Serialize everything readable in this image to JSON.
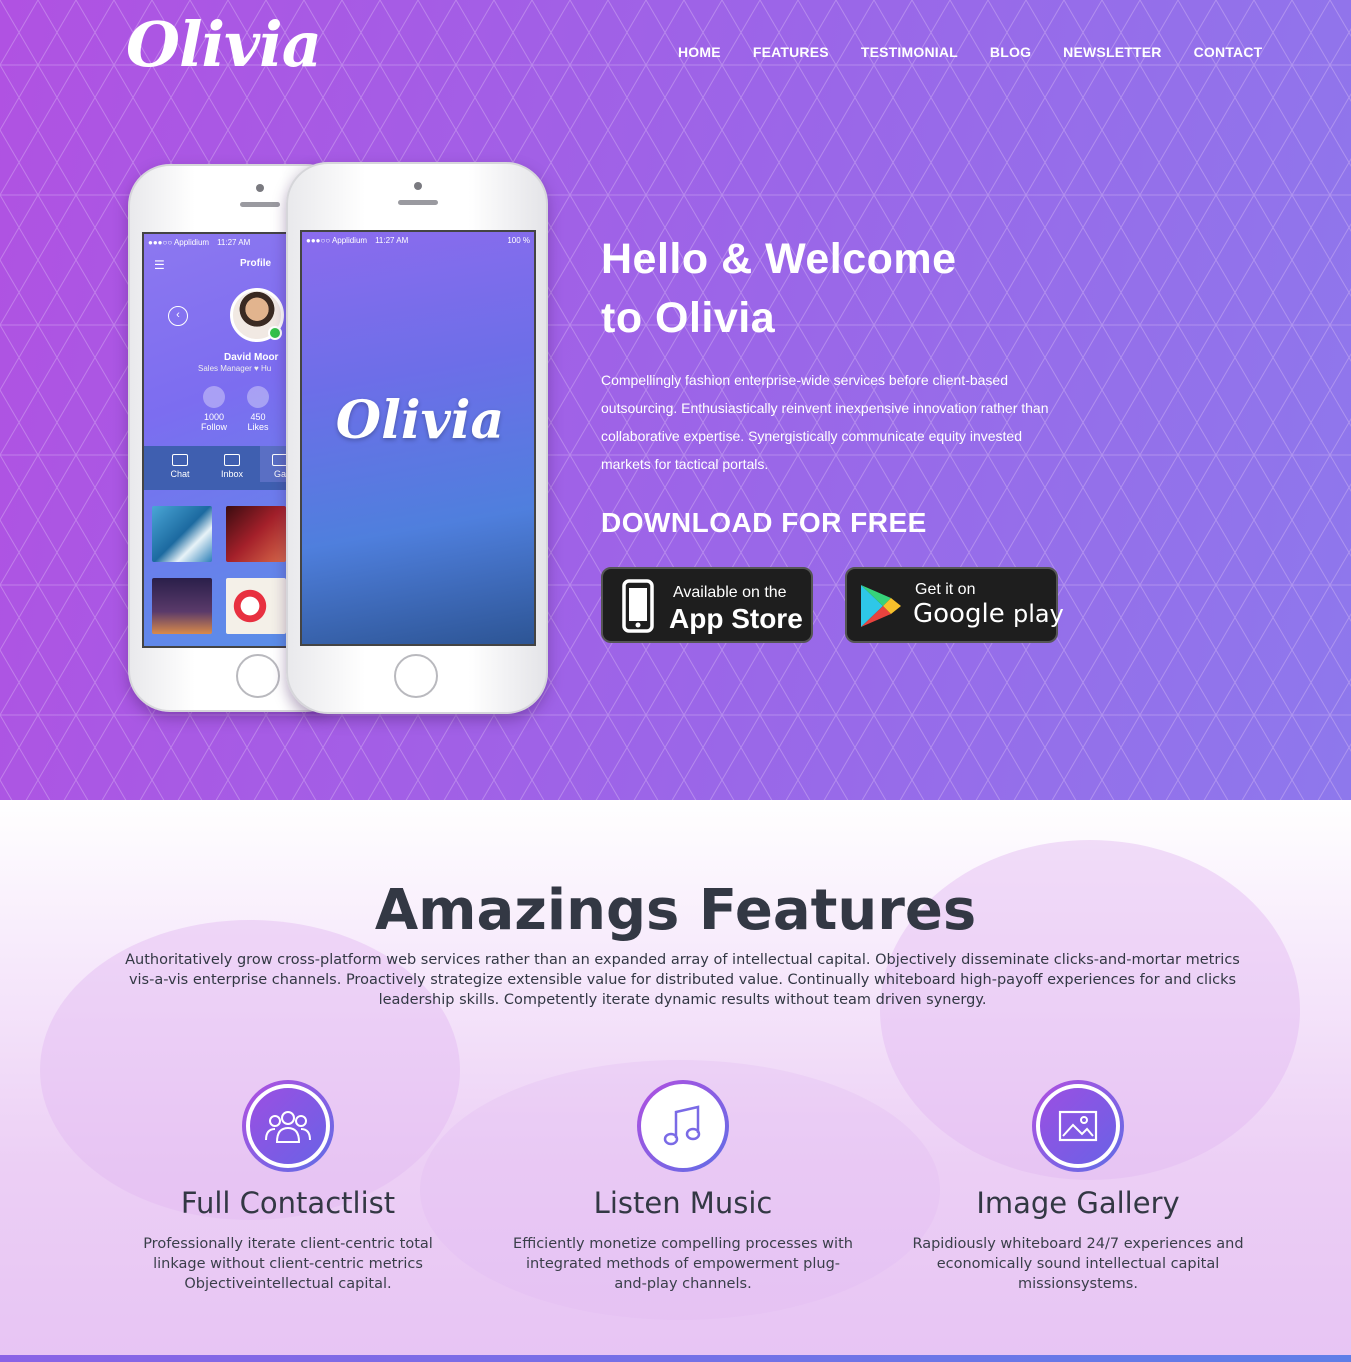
{
  "brand": {
    "logo_text": "Olivia"
  },
  "nav": {
    "items": [
      {
        "label": "HOME"
      },
      {
        "label": "FEATURES"
      },
      {
        "label": "TESTIMONIAL"
      },
      {
        "label": "BLOG"
      },
      {
        "label": "NEWSLETTER"
      },
      {
        "label": "CONTACT"
      }
    ]
  },
  "hero": {
    "title_line1": "Hello & Welcome",
    "title_line2": "to Olivia",
    "description": "Compellingly fashion enterprise-wide services before client-based outsourcing. Enthusiastically reinvent inexpensive innovation rather than collaborative expertise. Synergistically communicate equity invested markets for tactical portals.",
    "download_label": "DOWNLOAD FOR FREE",
    "app_store": {
      "small": "Available on the",
      "big": "App Store"
    },
    "google_play": {
      "small": "Get it on",
      "big_google": "Google",
      "big_play": "play"
    }
  },
  "phone_back": {
    "carrier": "●●●○○ Applidium",
    "time": "11:27 AM",
    "screen_title": "Profile",
    "profile_name": "David Moor",
    "profile_role": "Sales Manager  ♥ Hu",
    "stats": [
      {
        "value": "1000",
        "label": "Follow"
      },
      {
        "value": "450",
        "label": "Likes"
      }
    ],
    "tabs": [
      {
        "label": "Chat"
      },
      {
        "label": "Inbox"
      },
      {
        "label": "Ga"
      }
    ]
  },
  "phone_front": {
    "carrier": "●●●○○ Applidium",
    "time": "11:27 AM",
    "battery": "100 %",
    "splash_logo": "Olivia"
  },
  "features": {
    "title": "Amazings Features",
    "description": "Authoritatively grow cross-platform web services rather than an expanded array of intellectual capital. Objectively disseminate clicks-and-mortar metrics vis-a-vis enterprise channels. Proactively strategize extensible value for distributed value. Continually whiteboard high-payoff experiences for and clicks leadership skills. Competently iterate dynamic results without team driven synergy.",
    "items": [
      {
        "icon": "users-icon",
        "name": "Full Contactlist",
        "text": "Professionally iterate client-centric total linkage without client-centric metrics Objectiveintellectual capital."
      },
      {
        "icon": "music-icon",
        "name": "Listen Music",
        "text": "Efficiently monetize compelling processes with integrated methods of empowerment plug-and-play channels."
      },
      {
        "icon": "image-icon",
        "name": "Image Gallery",
        "text": "Rapidiously whiteboard 24/7 experiences and economically sound intellectual capital missionsystems."
      }
    ]
  },
  "colors": {
    "hero_start": "#b052e2",
    "hero_end": "#8e78ec",
    "text_dark": "#333844",
    "accent_purple": "#9b4fe2",
    "accent_blue": "#5f6ee6"
  }
}
